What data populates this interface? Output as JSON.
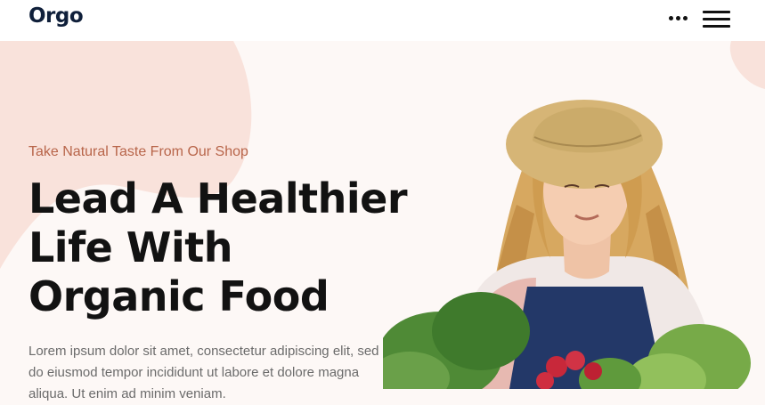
{
  "header": {
    "logo": "Orgo",
    "more_icon": "more-dots-icon",
    "menu_icon": "hamburger-menu-icon"
  },
  "hero": {
    "tagline": "Take Natural Taste From Our Shop",
    "headline_lines": [
      "Lead A Healthier",
      "Life With",
      "Organic Food"
    ],
    "paragraph": "Lorem ipsum dolor sit amet, consectetur adipiscing elit, sed do eiusmod tempor incididunt ut labore et dolore magna aliqua. Ut enim ad minim veniam.",
    "image": "woman-in-straw-hat-holding-vegetables"
  },
  "colors": {
    "background": "#fdf8f6",
    "blob": "#f9e2db",
    "accent": "#b8654a",
    "heading": "#121212",
    "body_text": "#6b6b6b",
    "logo": "#0f1f3a"
  }
}
